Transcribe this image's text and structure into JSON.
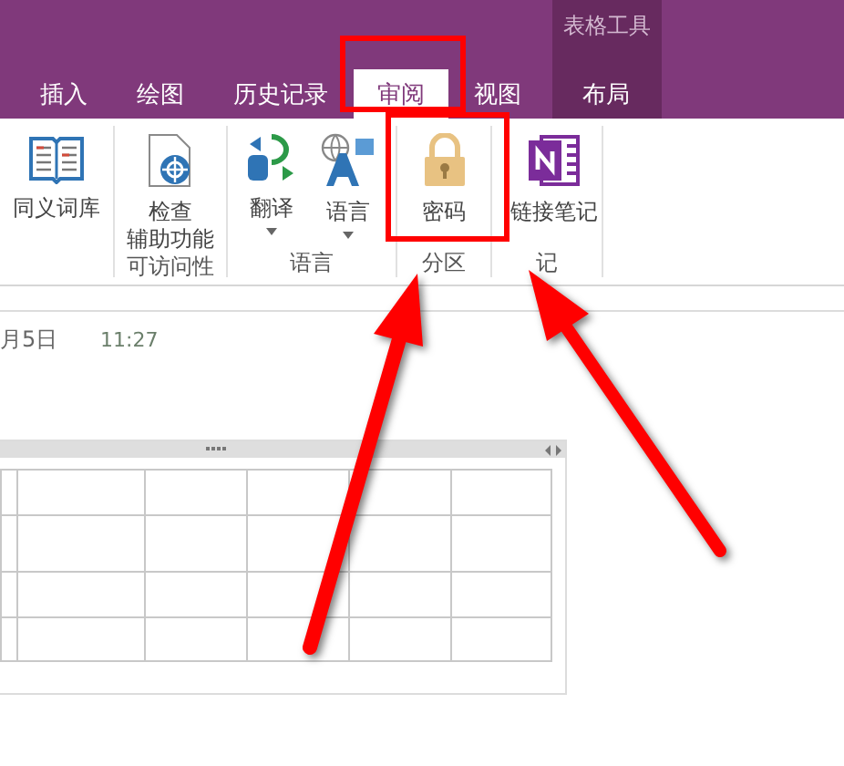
{
  "window": {
    "contextual_group": "表格工具"
  },
  "tabs": [
    {
      "label": "插入",
      "selected": false,
      "contextual": false
    },
    {
      "label": "绘图",
      "selected": false,
      "contextual": false
    },
    {
      "label": "历史记录",
      "selected": false,
      "contextual": false
    },
    {
      "label": "审阅",
      "selected": true,
      "contextual": false
    },
    {
      "label": "视图",
      "selected": false,
      "contextual": false
    },
    {
      "label": "布局",
      "selected": false,
      "contextual": true
    }
  ],
  "ribbon": {
    "groups": [
      {
        "buttons": [
          {
            "lines": [
              "同义词库"
            ],
            "kind": "book",
            "dropdown": false
          }
        ]
      },
      {
        "label": "可访问性",
        "buttons": [
          {
            "lines": [
              "检查",
              "辅助功能"
            ],
            "kind": "check",
            "dropdown": false
          }
        ]
      },
      {
        "label": "语言",
        "buttons": [
          {
            "lines": [
              "翻译"
            ],
            "kind": "translate",
            "dropdown": true
          },
          {
            "lines": [
              "语言"
            ],
            "kind": "language",
            "dropdown": true
          }
        ]
      },
      {
        "label": "分区",
        "buttons": [
          {
            "lines": [
              "密码"
            ],
            "kind": "lock",
            "dropdown": false
          }
        ]
      },
      {
        "label": "记",
        "buttons": [
          {
            "lines": [
              "链接笔记"
            ],
            "kind": "notebook",
            "dropdown": false
          }
        ]
      }
    ]
  },
  "page": {
    "date": "月5日",
    "time": "11:27"
  }
}
